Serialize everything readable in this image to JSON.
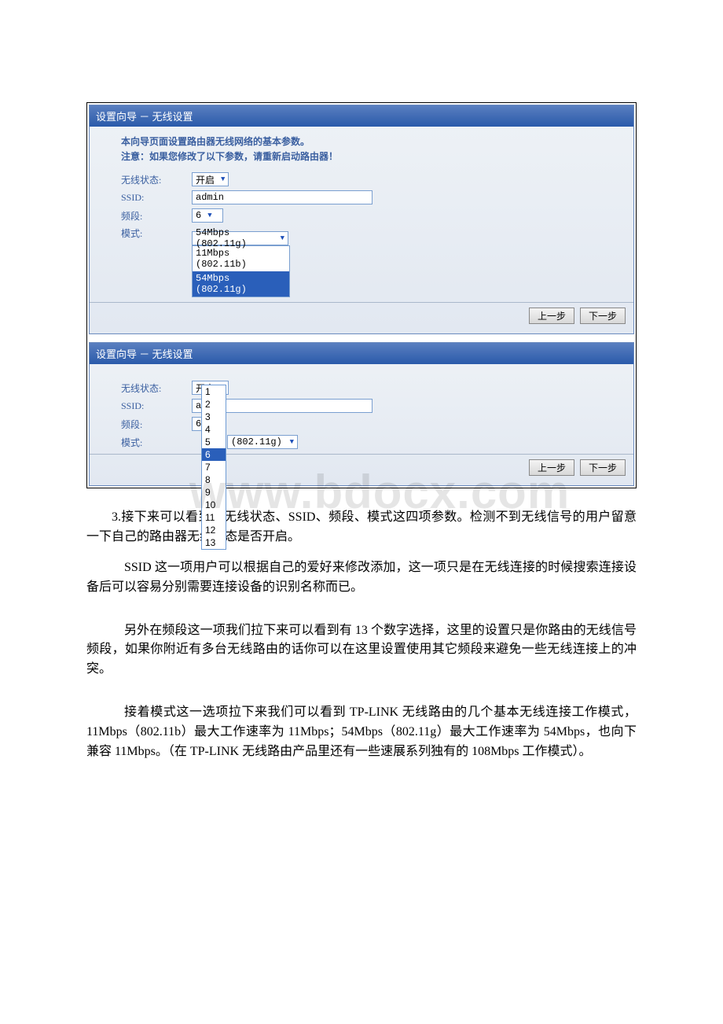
{
  "panel1": {
    "title": "设置向导 － 无线设置",
    "intro_line1": "本向导页面设置路由器无线网络的基本参数。",
    "intro_line2": "注意：如果您修改了以下参数，请重新启动路由器！",
    "label_status": "无线状态:",
    "label_ssid": "SSID:",
    "label_channel": "频段:",
    "label_mode": "模式:",
    "status_value": "开启",
    "ssid_value": "admin",
    "channel_value": "6",
    "mode_top": "54Mbps (802.11g)",
    "mode_opt1": "11Mbps (802.11b)",
    "mode_opt2": "54Mbps (802.11g)",
    "btn_prev": "上一步",
    "btn_next": "下一步"
  },
  "panel2": {
    "title": "设置向导 － 无线设置",
    "label_status": "无线状态:",
    "label_ssid": "SSID:",
    "label_channel": "频段:",
    "label_mode": "模式:",
    "status_value": "开启",
    "ssid_value": "admin",
    "channel_value": "6",
    "mode_value": "(802.11g)",
    "btn_prev": "上一步",
    "btn_next": "下一步",
    "channels": [
      "1",
      "2",
      "3",
      "4",
      "5",
      "6",
      "7",
      "8",
      "9",
      "10",
      "11",
      "12",
      "13"
    ],
    "channel_selected": "6"
  },
  "watermark": "www.bdocx.com",
  "para1": "3.接下来可以看到有无线状态、SSID、频段、模式这四项参数。检测不到无线信号的用户留意一下自己的路由器无线状态是否开启。",
  "para2": "SSID 这一项用户可以根据自己的爱好来修改添加，这一项只是在无线连接的时候搜索连接设备后可以容易分别需要连接设备的识别名称而已。",
  "para3": "另外在频段这一项我们拉下来可以看到有 13 个数字选择，这里的设置只是你路由的无线信号频段，如果你附近有多台无线路由的话你可以在这里设置使用其它频段来避免一些无线连接上的冲突。",
  "para4": "接着模式这一选项拉下来我们可以看到 TP-LINK 无线路由的几个基本无线连接工作模式，11Mbps（802.11b）最大工作速率为 11Mbps；54Mbps（802.11g）最大工作速率为 54Mbps，也向下兼容 11Mbps。（在 TP-LINK 无线路由产品里还有一些速展系列独有的 108Mbps 工作模式）。"
}
